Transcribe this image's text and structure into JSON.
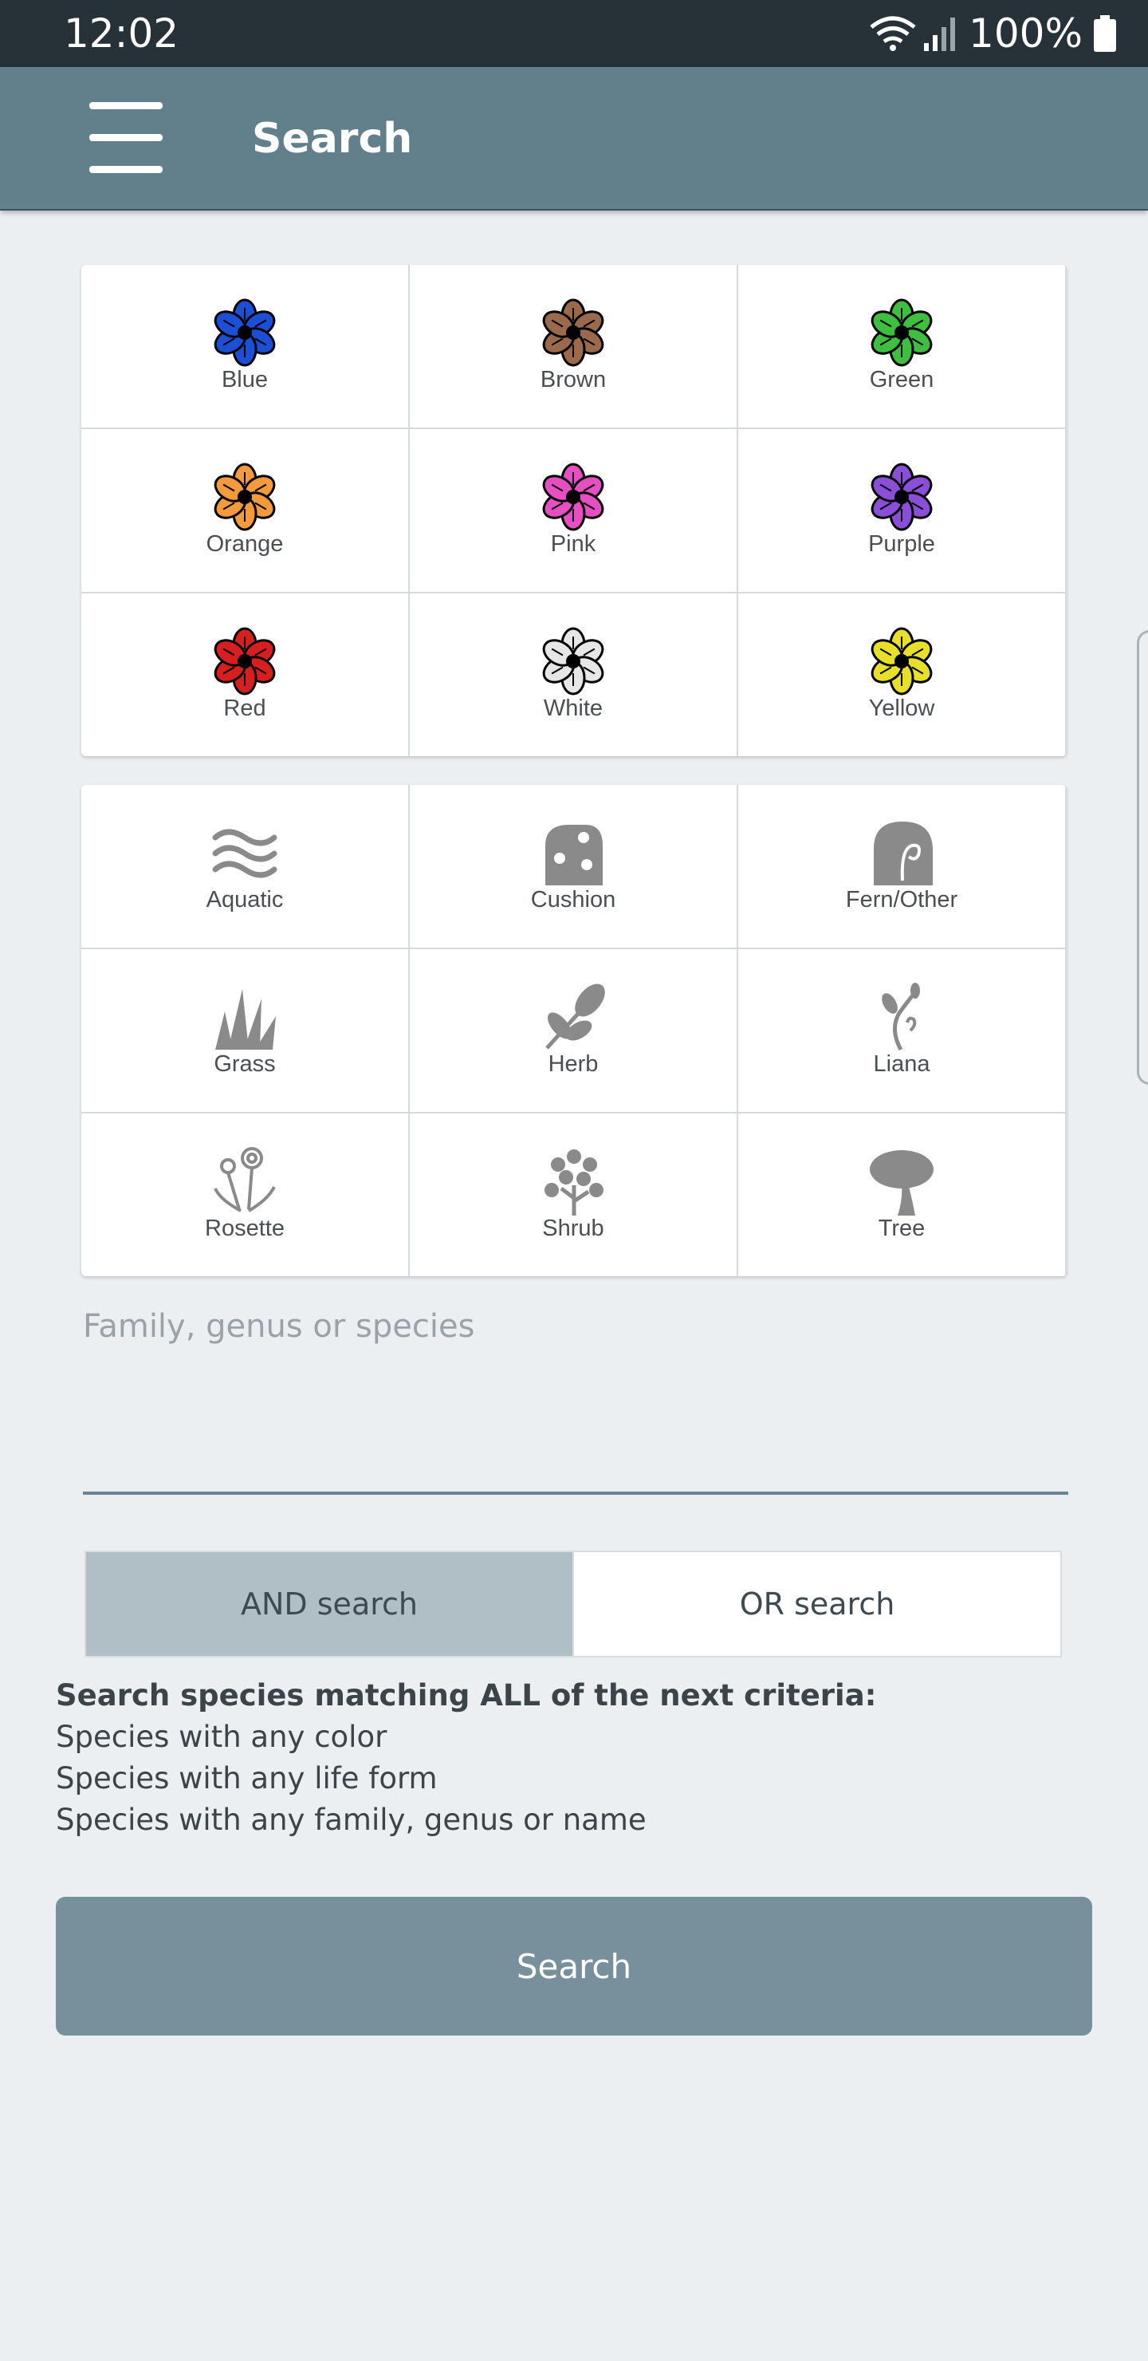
{
  "status_bar": {
    "time": "12:02",
    "battery": "100%",
    "icons": [
      "wifi-icon",
      "signal-icon",
      "battery-icon"
    ]
  },
  "app_bar": {
    "title": "Search",
    "menu_icon": "hamburger-menu-icon",
    "background": "#627f8c"
  },
  "colors": [
    {
      "label": "Blue",
      "color": "#1a4fd6"
    },
    {
      "label": "Brown",
      "color": "#9b6a4c"
    },
    {
      "label": "Green",
      "color": "#3fbf3f"
    },
    {
      "label": "Orange",
      "color": "#f39a3a"
    },
    {
      "label": "Pink",
      "color": "#e64fc2"
    },
    {
      "label": "Purple",
      "color": "#8a4fd6"
    },
    {
      "label": "Red",
      "color": "#d81f1f"
    },
    {
      "label": "White",
      "color": "#e6e6e6"
    },
    {
      "label": "Yellow",
      "color": "#e8df2a"
    }
  ],
  "life_forms": [
    {
      "label": "Aquatic",
      "icon": "aquatic-icon"
    },
    {
      "label": "Cushion",
      "icon": "cushion-icon"
    },
    {
      "label": "Fern/Other",
      "icon": "fern-icon"
    },
    {
      "label": "Grass",
      "icon": "grass-icon"
    },
    {
      "label": "Herb",
      "icon": "herb-icon"
    },
    {
      "label": "Liana",
      "icon": "liana-icon"
    },
    {
      "label": "Rosette",
      "icon": "rosette-icon"
    },
    {
      "label": "Shrub",
      "icon": "shrub-icon"
    },
    {
      "label": "Tree",
      "icon": "tree-icon"
    }
  ],
  "search_field": {
    "label": "Family, genus or species",
    "value": ""
  },
  "mode_toggle": {
    "and_label": "AND search",
    "or_label": "OR search",
    "selected": "AND search"
  },
  "criteria": {
    "title": "Search species matching ALL of the next criteria:",
    "lines": [
      "Species with any color",
      "Species with any life form",
      "Species with any family, genus or name"
    ]
  },
  "search_button": {
    "label": "Search"
  }
}
